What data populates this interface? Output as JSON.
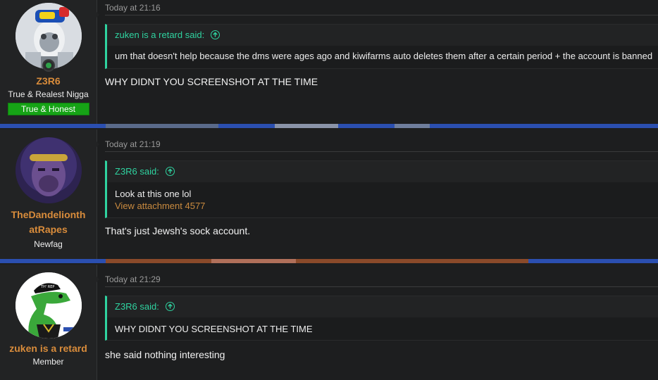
{
  "posts": [
    {
      "username": "Z3R6",
      "user_title": "True & Realest Nigga",
      "badge": "True & Honest",
      "date": "Today at 21:16",
      "quote_author": "zuken is a retard said:",
      "quote_text": "um that doesn't help because the dms were ages ago and kiwifarms auto deletes them after a certain period + the account is banned",
      "message": "WHY DIDNT YOU SCREENSHOT AT THE TIME"
    },
    {
      "username_line1": "TheDandelionth",
      "username_line2": "atRapes",
      "user_title": "Newfag",
      "date": "Today at 21:19",
      "quote_author": "Z3R6 said:",
      "quote_text": "Look at this one lol",
      "attachment": "View attachment 4577",
      "message": "That's just Jewsh's sock account."
    },
    {
      "username": "zuken is a retard",
      "user_title": "Member",
      "date": "Today at 21:29",
      "quote_author": "Z3R6 said:",
      "quote_text": "WHY DIDNT YOU SCREENSHOT AT THE TIME",
      "message": "she said nothing interesting",
      "avatar_cap_text": "TH' REP"
    }
  ],
  "colors": {
    "username": "#d98c3b",
    "quote_accent": "#2fd3a0",
    "badge_green": "#16a316",
    "background": "#1d1e1f"
  },
  "icons": {
    "quote_jump": "arrow-up-circle-icon",
    "online": "online-status-icon"
  }
}
